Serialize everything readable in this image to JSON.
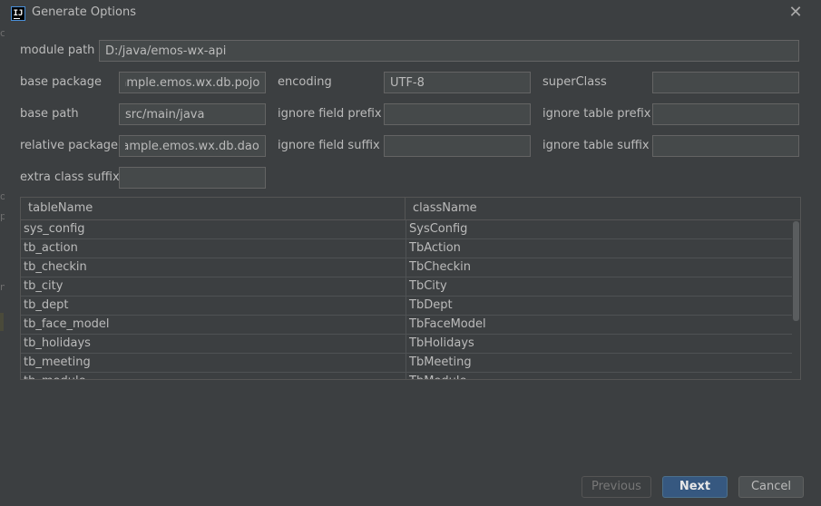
{
  "window": {
    "title": "Generate Options",
    "close_icon": "close-icon"
  },
  "form": {
    "module_path": {
      "label": "module path",
      "value": "D:/java/emos-wx-api"
    },
    "base_package": {
      "label": "base package",
      "value": "com.example.emos.wx.db.pojo"
    },
    "encoding": {
      "label": "encoding",
      "value": "UTF-8"
    },
    "super_class": {
      "label": "superClass",
      "value": ""
    },
    "base_path": {
      "label": "base path",
      "value": "src/main/java"
    },
    "ignore_field_prefix": {
      "label": "ignore field prefix",
      "value": ""
    },
    "ignore_table_prefix": {
      "label": "ignore table prefix",
      "value": ""
    },
    "relative_package": {
      "label": "relative package",
      "value": "com.example.emos.wx.db.dao"
    },
    "ignore_field_suffix": {
      "label": "ignore field suffix",
      "value": ""
    },
    "ignore_table_suffix": {
      "label": "ignore table suffix",
      "value": ""
    },
    "extra_class_suffix": {
      "label": "extra class suffix",
      "value": ""
    }
  },
  "table": {
    "columns": [
      "tableName",
      "className"
    ],
    "rows": [
      [
        "sys_config",
        "SysConfig"
      ],
      [
        "tb_action",
        "TbAction"
      ],
      [
        "tb_checkin",
        "TbCheckin"
      ],
      [
        "tb_city",
        "TbCity"
      ],
      [
        "tb_dept",
        "TbDept"
      ],
      [
        "tb_face_model",
        "TbFaceModel"
      ],
      [
        "tb_holidays",
        "TbHolidays"
      ],
      [
        "tb_meeting",
        "TbMeeting"
      ],
      [
        "tb_module",
        "TbModule"
      ]
    ]
  },
  "buttons": {
    "previous": "Previous",
    "next": "Next",
    "cancel": "Cancel"
  },
  "colors": {
    "background": "#3c3f41",
    "field": "#45494a",
    "primary_button": "#365880"
  }
}
